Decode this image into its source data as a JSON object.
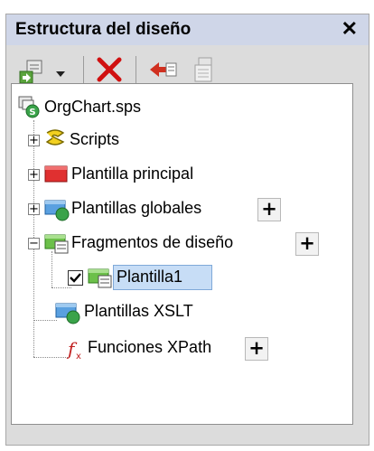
{
  "panel": {
    "title": "Estructura del diseño",
    "close_label": "✕"
  },
  "toolbar": {
    "items": [
      {
        "name": "add-item-icon"
      },
      {
        "name": "dropdown-arrow-icon"
      },
      {
        "name": "delete-icon"
      },
      {
        "name": "back-icon"
      },
      {
        "name": "properties-icon"
      }
    ]
  },
  "tree": {
    "root": {
      "label": "OrgChart.sps",
      "icon": "sps-file-icon"
    },
    "items": [
      {
        "label": "Scripts",
        "icon": "scripts-icon",
        "expander": "+"
      },
      {
        "label": "Plantilla principal",
        "icon": "main-template-icon",
        "expander": "+"
      },
      {
        "label": "Plantillas globales",
        "icon": "global-templates-icon",
        "expander": "+",
        "add": "+"
      },
      {
        "label": "Fragmentos de diseño",
        "icon": "design-fragments-icon",
        "expander": "−",
        "add": "+"
      },
      {
        "label": "Plantilla1",
        "icon": "fragment-icon",
        "checked": true,
        "selected": true
      },
      {
        "label": "Plantillas XSLT",
        "icon": "xslt-templates-icon"
      },
      {
        "label": "Funciones XPath",
        "icon": "xpath-functions-icon",
        "add": "+"
      }
    ]
  },
  "colors": {
    "titlebar": "#cfd6e8",
    "selection": "#c7ddf6",
    "delete": "#d01010"
  }
}
